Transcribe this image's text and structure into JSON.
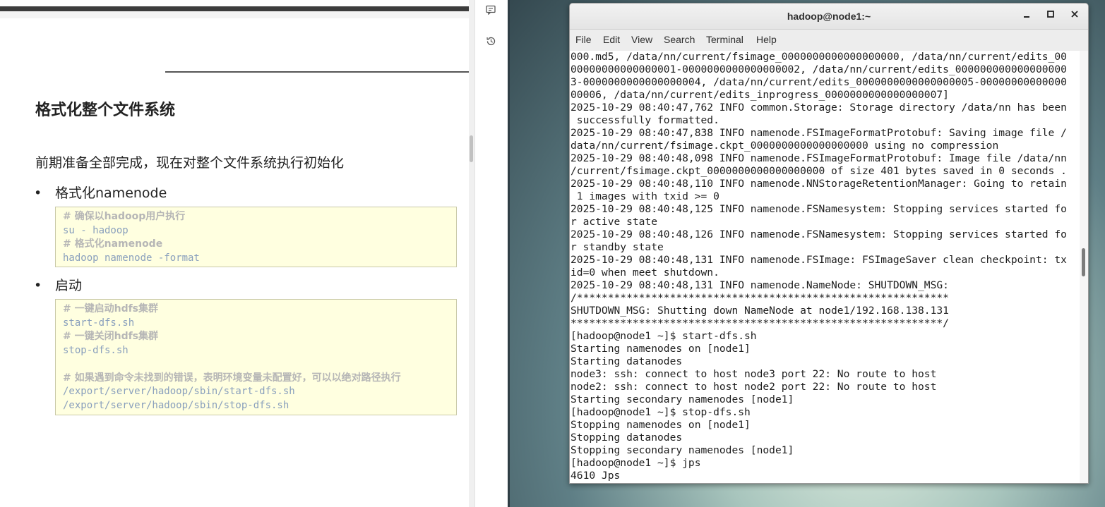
{
  "document": {
    "heading": "格式化整个文件系统",
    "intro": "前期准备全部完成，现在对整个文件系统执行初始化",
    "bullets": [
      {
        "label": "格式化namenode",
        "code": [
          {
            "type": "comment",
            "text": "# 确保以hadoop用户执行"
          },
          {
            "type": "cmd",
            "text": "su - hadoop"
          },
          {
            "type": "comment",
            "text": "# 格式化namenode"
          },
          {
            "type": "cmd",
            "text": "hadoop namenode -format"
          }
        ]
      },
      {
        "label": "启动",
        "code": [
          {
            "type": "comment",
            "text": "# 一键启动hdfs集群"
          },
          {
            "type": "cmd",
            "text": "start-dfs.sh"
          },
          {
            "type": "comment",
            "text": "# 一键关闭hdfs集群"
          },
          {
            "type": "cmd",
            "text": "stop-dfs.sh"
          },
          {
            "type": "cmd",
            "text": ""
          },
          {
            "type": "comment",
            "text": "# 如果遇到命令未找到的错误，表明环境变量未配置好，可以以绝对路径执行"
          },
          {
            "type": "cmd",
            "text": "/export/server/hadoop/sbin/start-dfs.sh"
          },
          {
            "type": "cmd",
            "text": "/export/server/hadoop/sbin/stop-dfs.sh"
          }
        ]
      }
    ]
  },
  "rail": {
    "icons": [
      "comment-icon",
      "history-icon"
    ]
  },
  "terminal": {
    "title": "hadoop@node1:~",
    "buttons": {
      "minimize": "_",
      "maximize": "□",
      "close": "✕"
    },
    "menu": [
      "File",
      "Edit",
      "View",
      "Search",
      "Terminal",
      "Help"
    ],
    "lines": [
      "000.md5, /data/nn/current/fsimage_0000000000000000000, /data/nn/current/edits_00",
      "00000000000000001-0000000000000000002, /data/nn/current/edits_000000000000000000",
      "3-0000000000000000004, /data/nn/current/edits_0000000000000000005-00000000000000",
      "00006, /data/nn/current/edits_inprogress_0000000000000000007]",
      "2025-10-29 08:40:47,762 INFO common.Storage: Storage directory /data/nn has been",
      " successfully formatted.",
      "2025-10-29 08:40:47,838 INFO namenode.FSImageFormatProtobuf: Saving image file /",
      "data/nn/current/fsimage.ckpt_0000000000000000000 using no compression",
      "2025-10-29 08:40:48,098 INFO namenode.FSImageFormatProtobuf: Image file /data/nn",
      "/current/fsimage.ckpt_0000000000000000000 of size 401 bytes saved in 0 seconds .",
      "2025-10-29 08:40:48,110 INFO namenode.NNStorageRetentionManager: Going to retain",
      " 1 images with txid >= 0",
      "2025-10-29 08:40:48,125 INFO namenode.FSNamesystem: Stopping services started fo",
      "r active state",
      "2025-10-29 08:40:48,126 INFO namenode.FSNamesystem: Stopping services started fo",
      "r standby state",
      "2025-10-29 08:40:48,131 INFO namenode.FSImage: FSImageSaver clean checkpoint: tx",
      "id=0 when meet shutdown.",
      "2025-10-29 08:40:48,131 INFO namenode.NameNode: SHUTDOWN_MSG:",
      "/************************************************************",
      "SHUTDOWN_MSG: Shutting down NameNode at node1/192.168.138.131",
      "************************************************************/",
      "[hadoop@node1 ~]$ start-dfs.sh",
      "Starting namenodes on [node1]",
      "Starting datanodes",
      "node3: ssh: connect to host node3 port 22: No route to host",
      "node2: ssh: connect to host node2 port 22: No route to host",
      "Starting secondary namenodes [node1]",
      "[hadoop@node1 ~]$ stop-dfs.sh",
      "Stopping namenodes on [node1]",
      "Stopping datanodes",
      "Stopping secondary namenodes [node1]",
      "[hadoop@node1 ~]$ jps",
      "4610 Jps"
    ]
  }
}
